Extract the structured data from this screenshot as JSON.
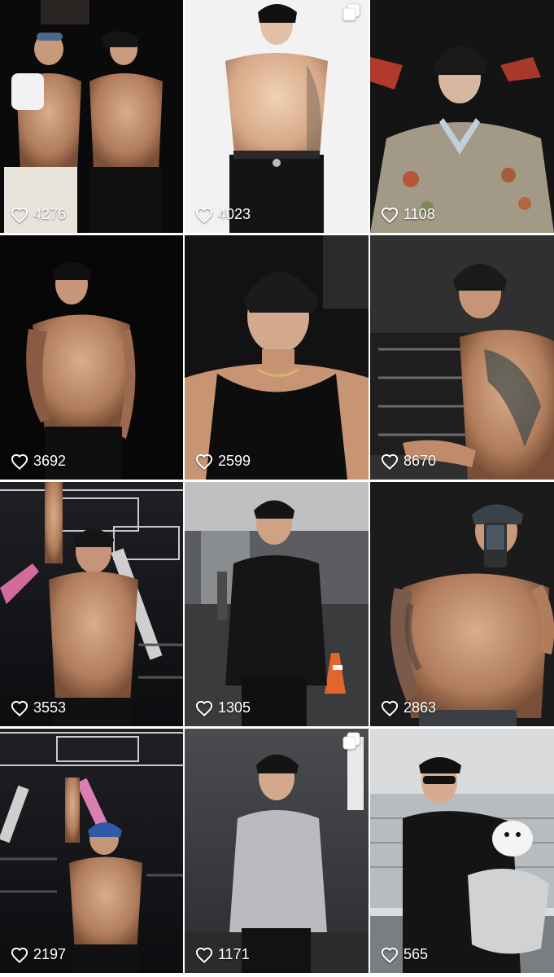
{
  "colors": {
    "background": "#ffffff",
    "overlay_text": "#ffffff"
  },
  "icons": {
    "like": "heart-outline-icon",
    "multi": "multiple-images-icon"
  },
  "tiles": [
    {
      "likes": "4276",
      "multi": false
    },
    {
      "likes": "4023",
      "multi": true
    },
    {
      "likes": "1108",
      "multi": false
    },
    {
      "likes": "3692",
      "multi": false
    },
    {
      "likes": "2599",
      "multi": false
    },
    {
      "likes": "8670",
      "multi": false
    },
    {
      "likes": "3553",
      "multi": false
    },
    {
      "likes": "1305",
      "multi": false
    },
    {
      "likes": "2863",
      "multi": false
    },
    {
      "likes": "2197",
      "multi": false
    },
    {
      "likes": "1171",
      "multi": true
    },
    {
      "likes": "565",
      "multi": false
    }
  ]
}
